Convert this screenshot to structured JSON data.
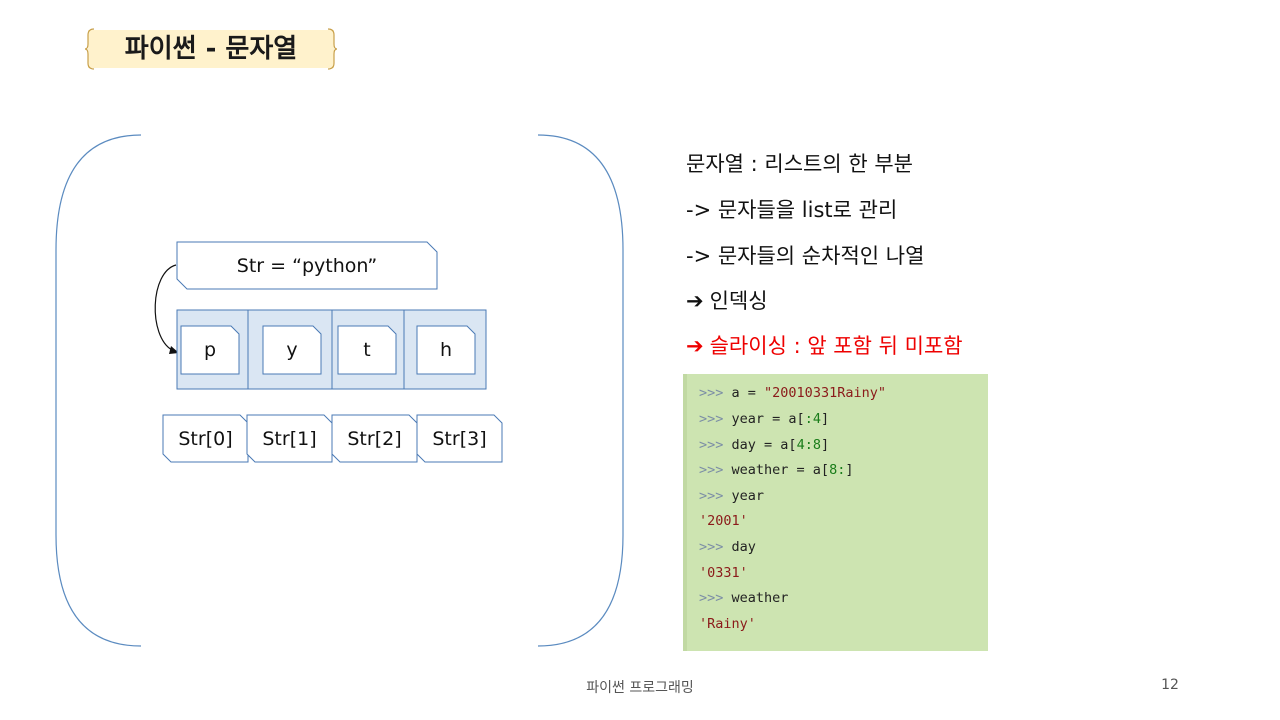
{
  "slide": {
    "title": "파이썬 - 문자열",
    "footer": "파이썬 프로그래밍",
    "page_number": "12"
  },
  "diagram": {
    "assignment": "Str = “python”",
    "chars": [
      "p",
      "y",
      "t",
      "h"
    ],
    "indices": [
      "Str[0]",
      "Str[1]",
      "Str[2]",
      "Str[3]"
    ]
  },
  "bullets": [
    {
      "text": "문자열 : 리스트의 한 부분",
      "color": "#111111"
    },
    {
      "text": "-> 문자들을 list로 관리",
      "color": "#111111"
    },
    {
      "text": "-> 문자들의 순차적인 나열",
      "color": "#111111"
    },
    {
      "arrow": "➔",
      "text": "인덱싱",
      "color": "#111111"
    },
    {
      "arrow": "➔",
      "text": "슬라이싱 : 앞 포함 뒤 미포함",
      "color": "#ee0000"
    }
  ],
  "code": {
    "prompt": ">>>",
    "lines": [
      {
        "a": "a = ",
        "b": "\"20010331Rainy\""
      },
      {
        "a": "year = a[",
        "b": ":4",
        "c": "]"
      },
      {
        "a": "day = a[",
        "b": "4:8",
        "c": "]"
      },
      {
        "a": "weather = a[",
        "b": "8:",
        "c": "]"
      },
      {
        "a": "year"
      },
      {
        "out": "'2001'"
      },
      {
        "a": "day"
      },
      {
        "out": "'0331'"
      },
      {
        "a": "weather"
      },
      {
        "out": "'Rainy'"
      }
    ]
  }
}
